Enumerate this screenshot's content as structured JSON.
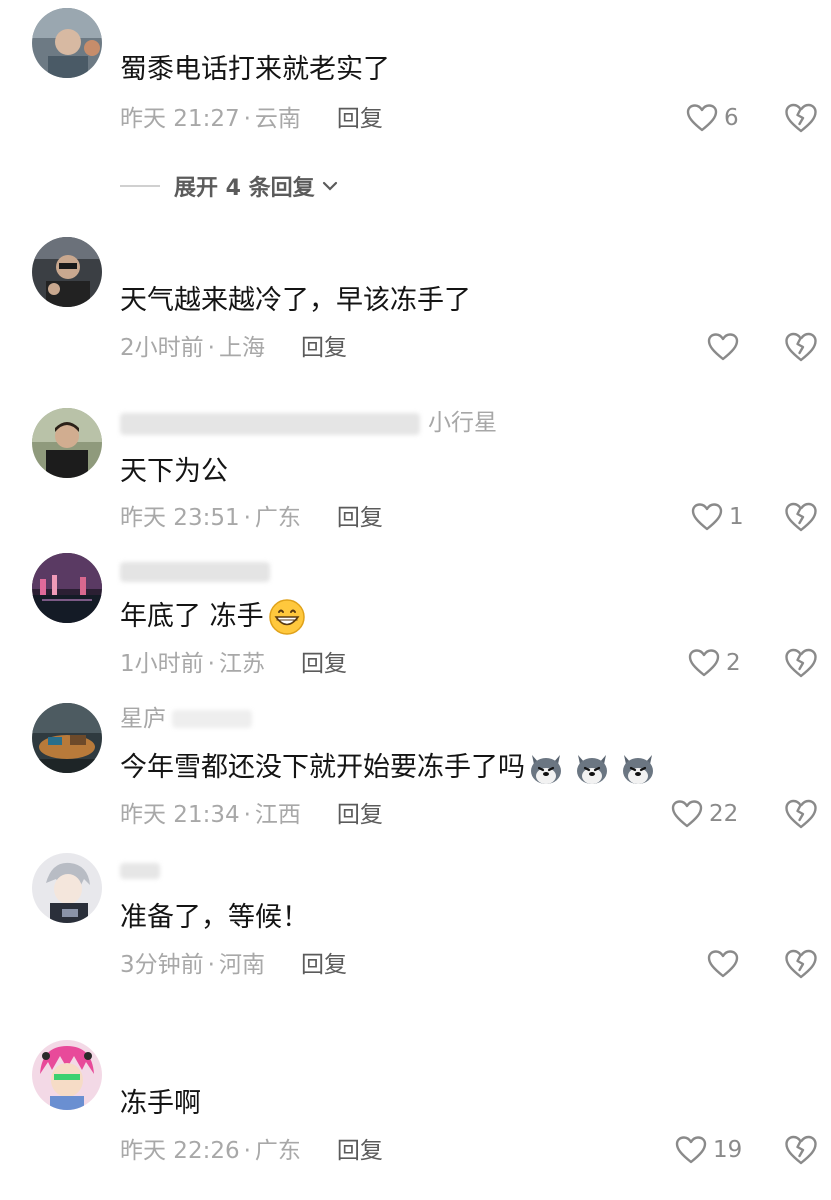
{
  "comments": [
    {
      "username": "",
      "text": "蜀黍电话打来就老实了",
      "time": "昨天 21:27",
      "location": "云南",
      "reply_label": "回复",
      "likes": "6",
      "replies_expand": "展开 4 条回复"
    },
    {
      "username": "",
      "text": "天气越来越冷了，早该冻手了",
      "time": "2小时前",
      "location": "上海",
      "reply_label": "回复",
      "likes": ""
    },
    {
      "username": "小行星",
      "text": "天下为公",
      "time": "昨天 23:51",
      "location": "广东",
      "reply_label": "回复",
      "likes": "1"
    },
    {
      "username": "",
      "text": "年底了 冻手",
      "time": "1小时前",
      "location": "江苏",
      "reply_label": "回复",
      "likes": "2",
      "emoji": "grin-emoji"
    },
    {
      "username": "星庐",
      "text": "今年雪都还没下就开始要冻手了吗",
      "time": "昨天 21:34",
      "location": "江西",
      "reply_label": "回复",
      "likes": "22",
      "emoji": "husky-emoji"
    },
    {
      "username": "",
      "text": "准备了，等候！",
      "time": "3分钟前",
      "location": "河南",
      "reply_label": "回复",
      "likes": ""
    },
    {
      "username": "",
      "text": "冻手啊",
      "time": "昨天 22:26",
      "location": "广东",
      "reply_label": "回复",
      "likes": "19"
    }
  ],
  "separator": "·",
  "colors": {
    "text": "#141414",
    "meta": "#a8a8a8",
    "icon": "#8a8a8a"
  }
}
